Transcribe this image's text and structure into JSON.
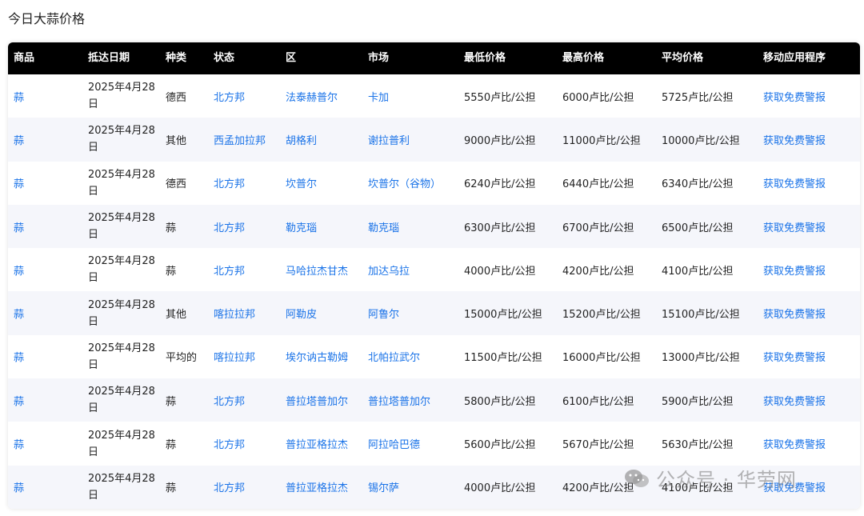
{
  "page": {
    "title": "今日大蒜价格"
  },
  "table": {
    "headers": [
      "商品",
      "抵达日期",
      "种类",
      "状态",
      "区",
      "市场",
      "最低价格",
      "最高价格",
      "平均价格",
      "移动应用程序"
    ],
    "rows": [
      [
        "蒜",
        "2025年4月28日",
        "德西",
        "北方邦",
        "法泰赫普尔",
        "卡加",
        "5550卢比/公担",
        "6000卢比/公担",
        "5725卢比/公担",
        "获取免费警报"
      ],
      [
        "蒜",
        "2025年4月28日",
        "其他",
        "西孟加拉邦",
        "胡格利",
        "谢拉普利",
        "9000卢比/公担",
        "11000卢比/公担",
        "10000卢比/公担",
        "获取免费警报"
      ],
      [
        "蒜",
        "2025年4月28日",
        "德西",
        "北方邦",
        "坎普尔",
        "坎普尔（谷物）",
        "6240卢比/公担",
        "6440卢比/公担",
        "6340卢比/公担",
        "获取免费警报"
      ],
      [
        "蒜",
        "2025年4月28日",
        "蒜",
        "北方邦",
        "勒克瑙",
        "勒克瑙",
        "6300卢比/公担",
        "6700卢比/公担",
        "6500卢比/公担",
        "获取免费警报"
      ],
      [
        "蒜",
        "2025年4月28日",
        "蒜",
        "北方邦",
        "马哈拉杰甘杰",
        "加达乌拉",
        "4000卢比/公担",
        "4200卢比/公担",
        "4100卢比/公担",
        "获取免费警报"
      ],
      [
        "蒜",
        "2025年4月28日",
        "其他",
        "喀拉拉邦",
        "阿勒皮",
        "阿鲁尔",
        "15000卢比/公担",
        "15200卢比/公担",
        "15100卢比/公担",
        "获取免费警报"
      ],
      [
        "蒜",
        "2025年4月28日",
        "平均的",
        "喀拉拉邦",
        "埃尔讷古勒姆",
        "北帕拉武尔",
        "11500卢比/公担",
        "16000卢比/公担",
        "13000卢比/公担",
        "获取免费警报"
      ],
      [
        "蒜",
        "2025年4月28日",
        "蒜",
        "北方邦",
        "普拉塔普加尔",
        "普拉塔普加尔",
        "5800卢比/公担",
        "6100卢比/公担",
        "5900卢比/公担",
        "获取免费警报"
      ],
      [
        "蒜",
        "2025年4月28日",
        "蒜",
        "北方邦",
        "普拉亚格拉杰",
        "阿拉哈巴德",
        "5600卢比/公担",
        "5670卢比/公担",
        "5630卢比/公担",
        "获取免费警报"
      ],
      [
        "蒜",
        "2025年4月28日",
        "蒜",
        "北方邦",
        "普拉亚格拉杰",
        "锡尔萨",
        "4000卢比/公担",
        "4200卢比/公担",
        "4100卢比/公担",
        "获取免费警报"
      ]
    ]
  },
  "watermark": {
    "text": "公众号 · 华劳网"
  },
  "colors": {
    "header_bg": "#000000",
    "link": "#1a73e8",
    "alt_row": "#f5f6fb"
  }
}
